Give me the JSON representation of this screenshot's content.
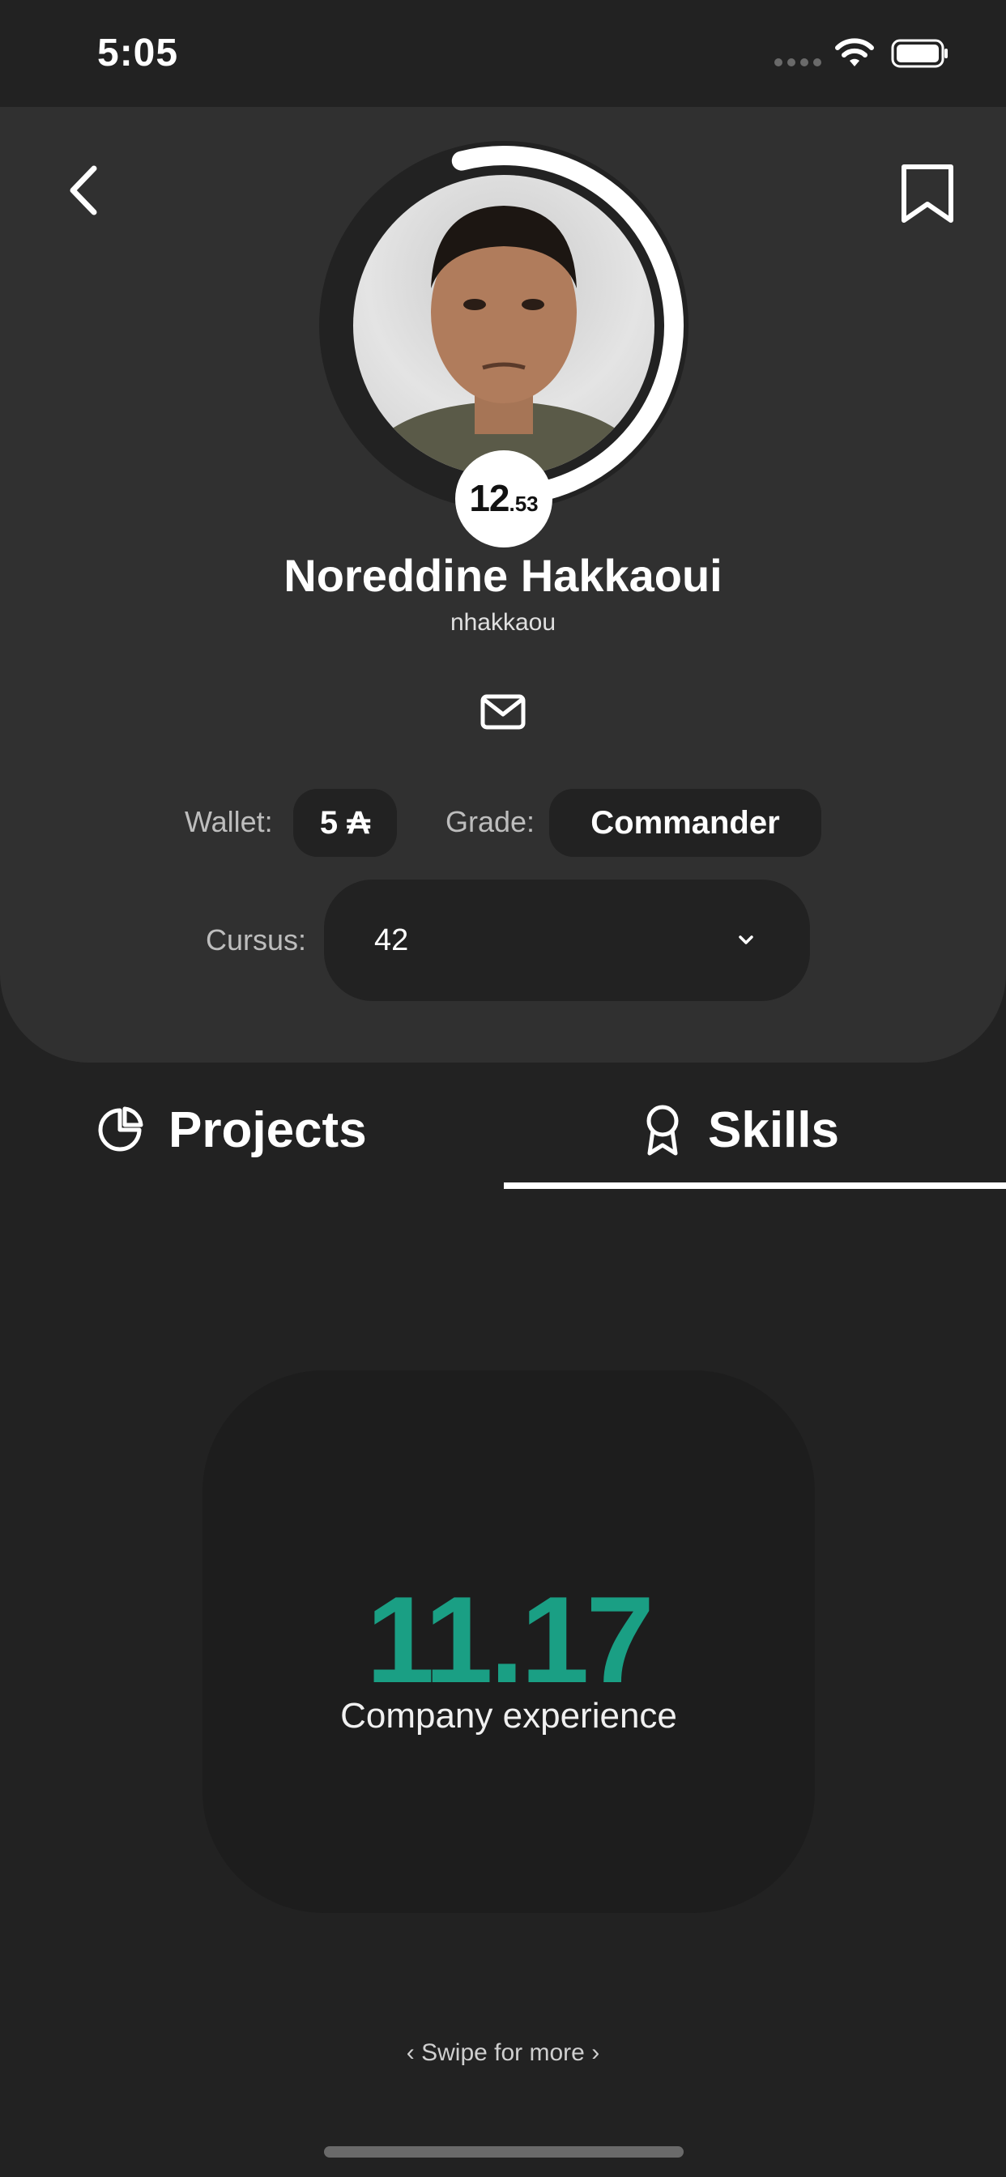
{
  "status_bar": {
    "time": "5:05"
  },
  "profile": {
    "level_integer": "12",
    "level_decimal": ".53",
    "level_progress": 0.53,
    "full_name": "Noreddine Hakkaoui",
    "login": "nhakkaou",
    "wallet_label": "Wallet:",
    "wallet_value": "5 ₳",
    "grade_label": "Grade:",
    "grade_value": "Commander",
    "cursus_label": "Cursus:",
    "cursus_value": "42"
  },
  "tabs": [
    {
      "label": "Projects",
      "icon": "pie-chart-icon"
    },
    {
      "label": "Skills",
      "icon": "award-icon",
      "active": true
    }
  ],
  "skill": {
    "value": "11.17",
    "name": "Company experience"
  },
  "footer": {
    "swipe_text": "‹ Swipe for more ›"
  },
  "colors": {
    "accent": "#1a9f84",
    "background": "#222222",
    "card": "#303030"
  }
}
